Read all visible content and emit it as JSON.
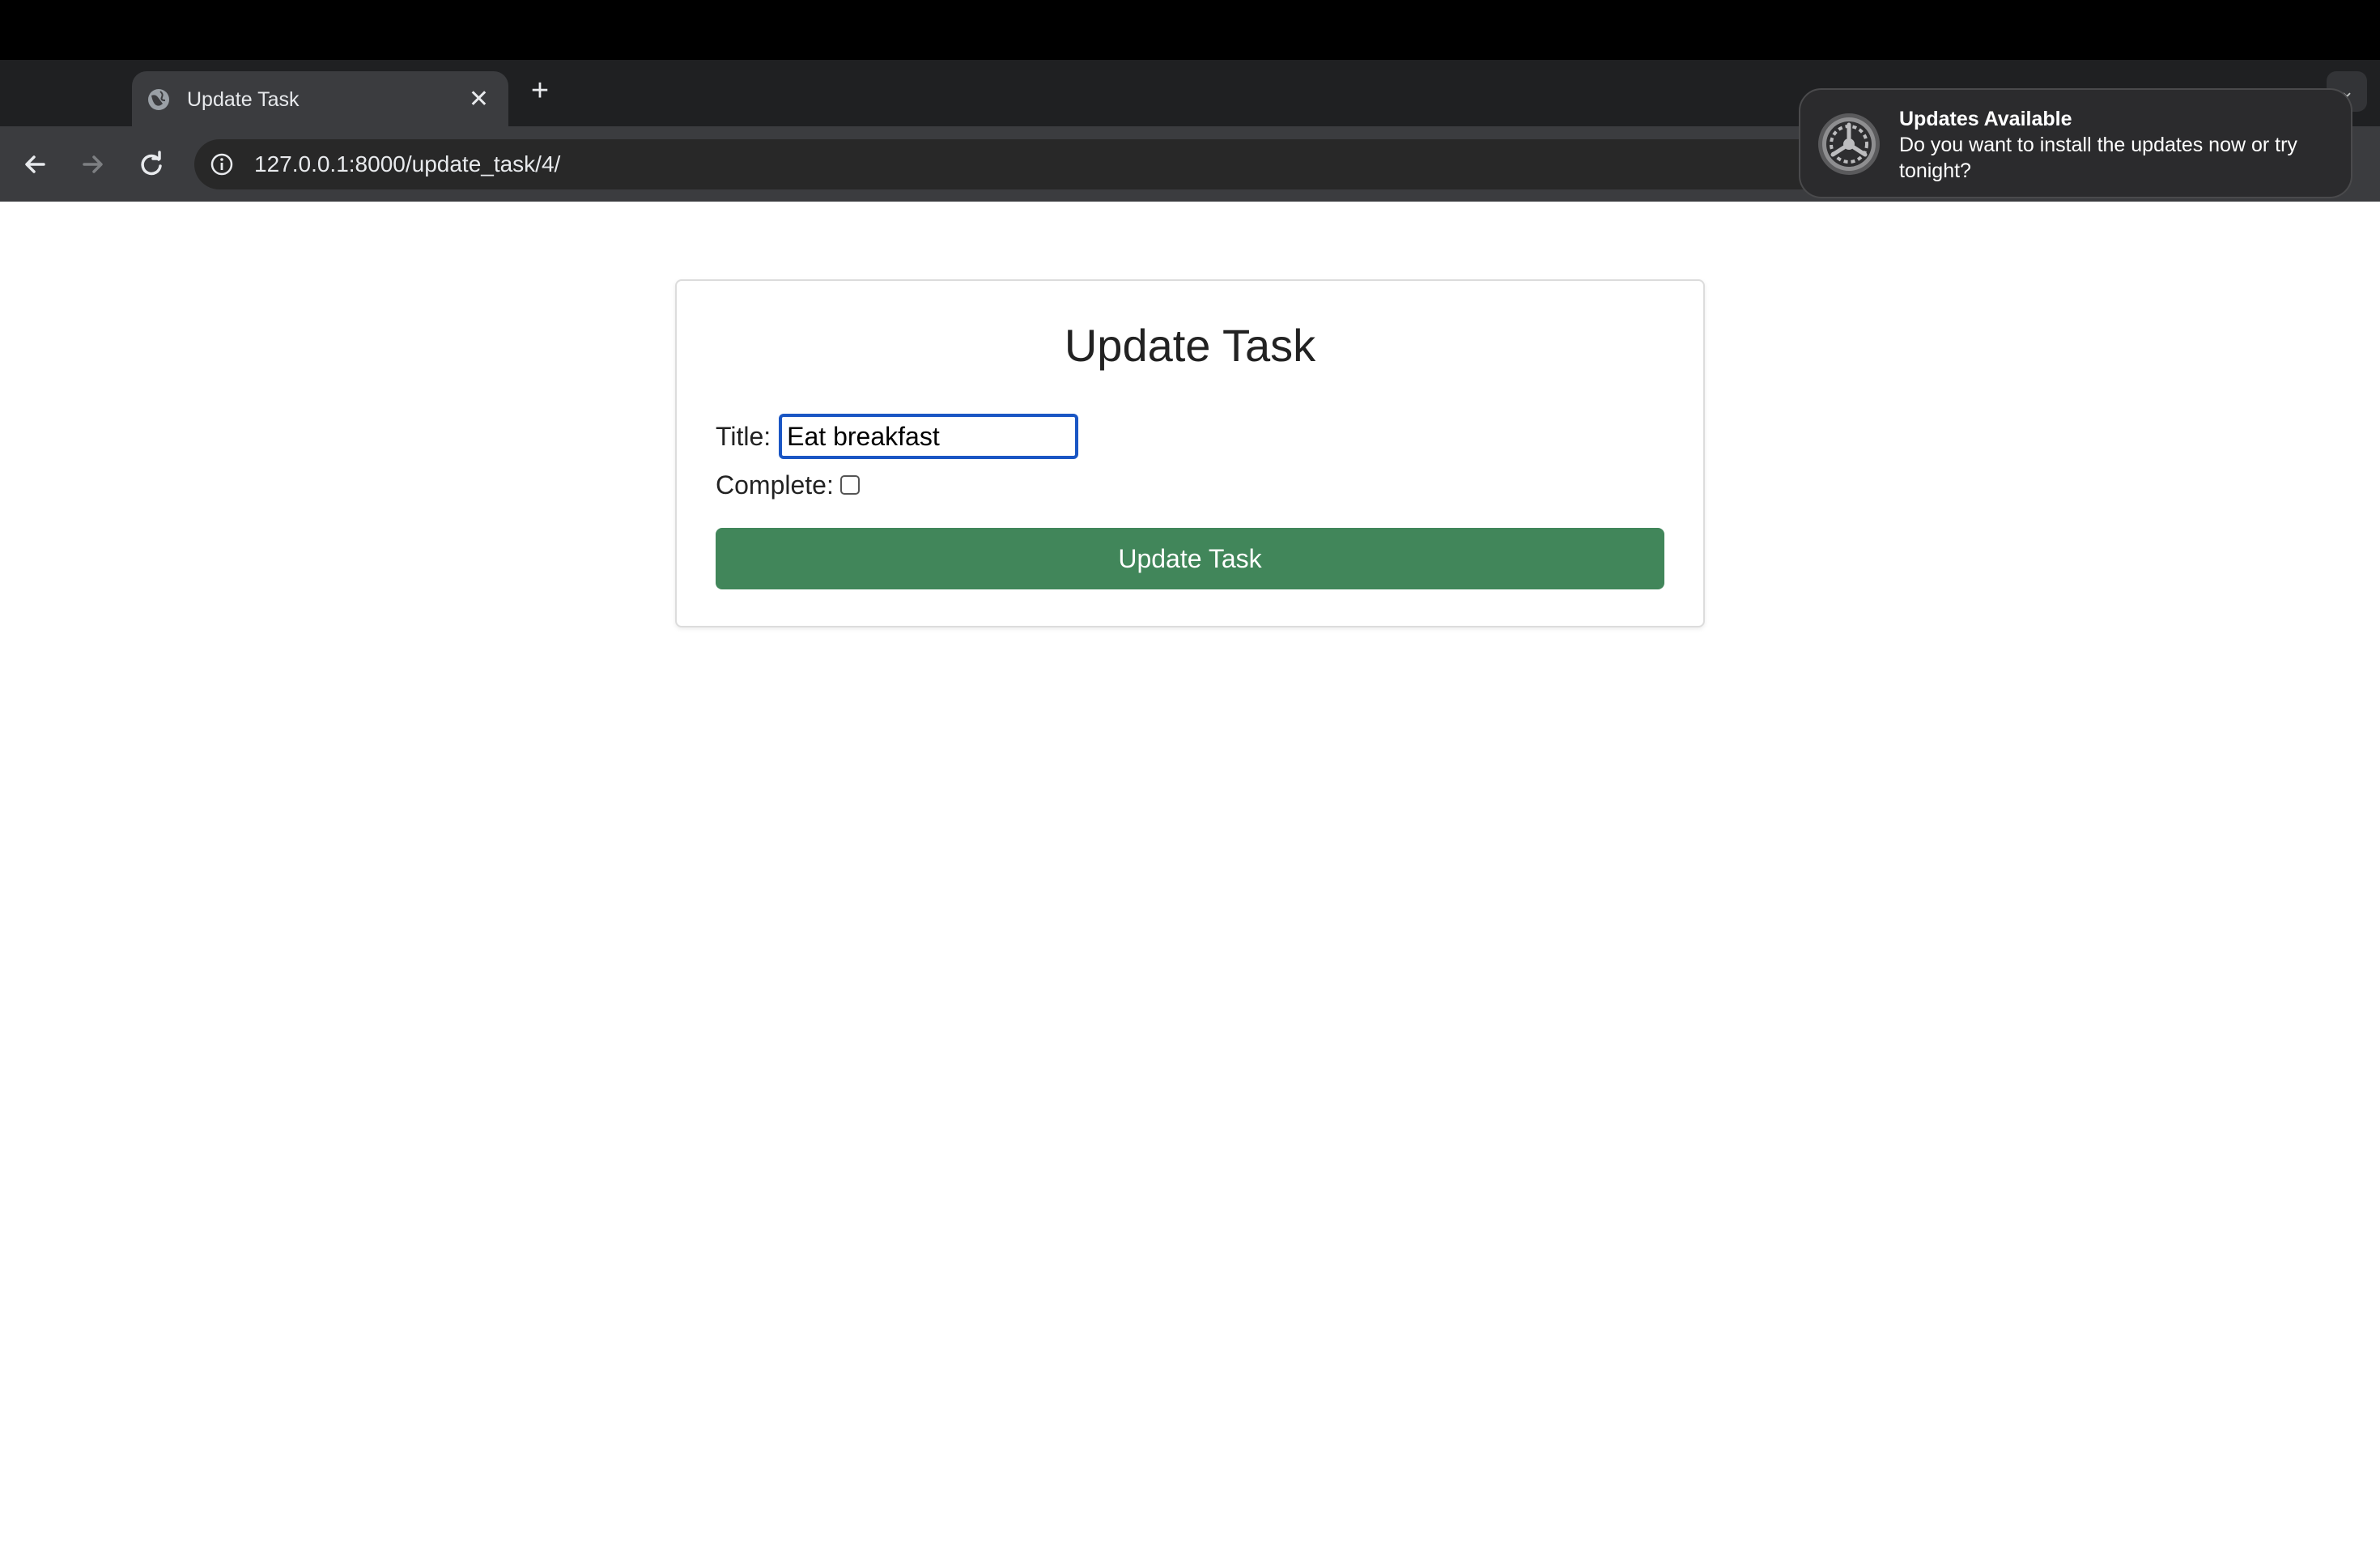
{
  "browser": {
    "tab": {
      "title": "Update Task"
    },
    "address_bar": {
      "url": "127.0.0.1:8000/update_task/4/"
    }
  },
  "notification": {
    "title": "Updates Available",
    "body": "Do you want to install the updates now or try tonight?"
  },
  "form": {
    "heading": "Update Task",
    "title_label": "Title:",
    "title_value": "Eat breakfast",
    "complete_label": "Complete:",
    "complete_checked": false,
    "submit_label": "Update Task"
  },
  "colors": {
    "submit_button": "#41865a",
    "input_focus": "#1a56c4"
  }
}
